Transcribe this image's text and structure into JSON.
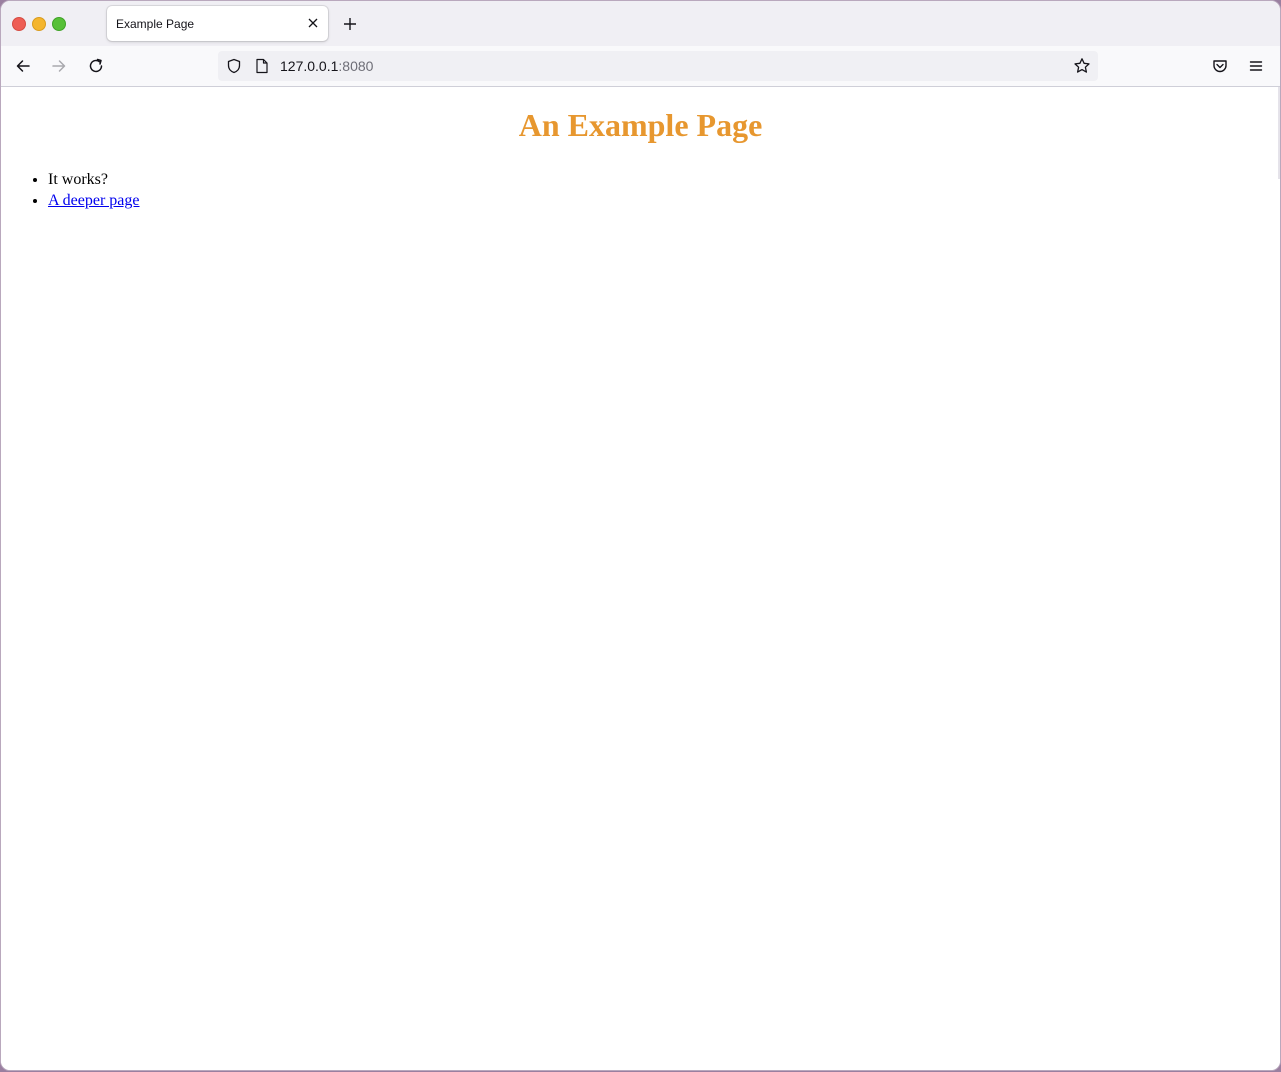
{
  "browser": {
    "tab_title": "Example Page",
    "url_host": "127.0.0.1",
    "url_port": ":8080"
  },
  "page": {
    "heading": "An Example Page",
    "heading_color": "#e7972f",
    "list_items": [
      {
        "text": "It works?",
        "link": false
      },
      {
        "text": "A deeper page",
        "link": true
      }
    ]
  },
  "icons": {
    "back": "back-arrow-icon",
    "forward": "forward-arrow-icon",
    "reload": "reload-icon",
    "shield": "shield-icon",
    "page": "page-icon",
    "star": "star-icon",
    "pocket": "pocket-icon",
    "menu": "hamburger-menu-icon",
    "close_tab": "close-icon",
    "new_tab": "plus-icon"
  }
}
